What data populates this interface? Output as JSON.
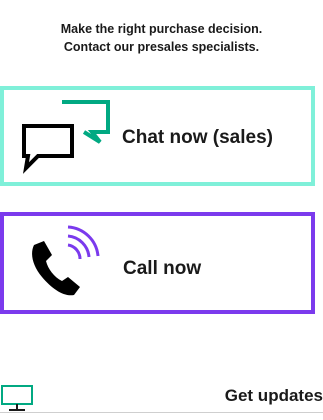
{
  "heading": {
    "line1": "Make the right purchase decision.",
    "line2": "Contact our presales specialists."
  },
  "chat_card": {
    "label": "Chat now (sales)",
    "icon": "chat-bubbles-icon",
    "border_color": "#7ff0d9"
  },
  "call_card": {
    "label": "Call now",
    "icon": "phone-ringing-icon",
    "border_color": "#7b3aed"
  },
  "bottom_bar": {
    "icon": "monitor-icon",
    "updates_label": "Get updates"
  },
  "colors": {
    "accent_teal": "#01a982",
    "accent_purple": "#7b3aed",
    "text": "#1a1a1a"
  }
}
